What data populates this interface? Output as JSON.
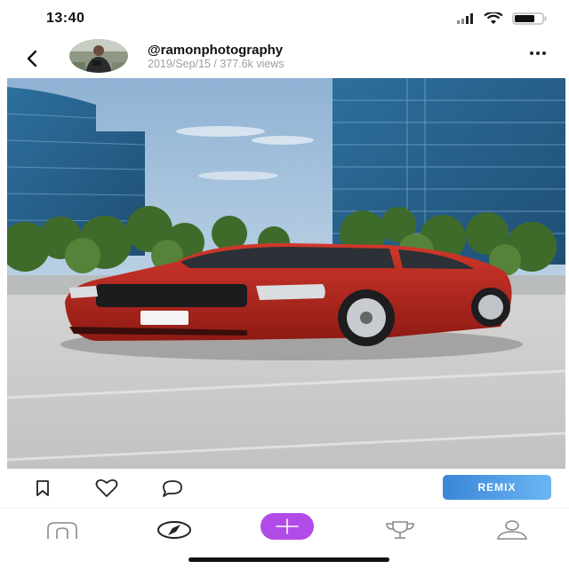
{
  "status": {
    "time": "13:40"
  },
  "post": {
    "username": "@ramonphotography",
    "meta": "2019/Sep/15 / 377.6k views"
  },
  "actions": {
    "remix_label": "REMIX"
  },
  "colors": {
    "accent": "#b04be8",
    "remix": "#3a86d8"
  },
  "icons": {
    "back": "chevron-left-icon",
    "more": "more-horizontal-icon",
    "bookmark": "bookmark-icon",
    "like": "heart-icon",
    "comment": "comment-icon",
    "home": "home-icon",
    "explore": "compass-icon",
    "create": "plus-icon",
    "leaderboard": "trophy-icon",
    "profile": "user-icon"
  }
}
